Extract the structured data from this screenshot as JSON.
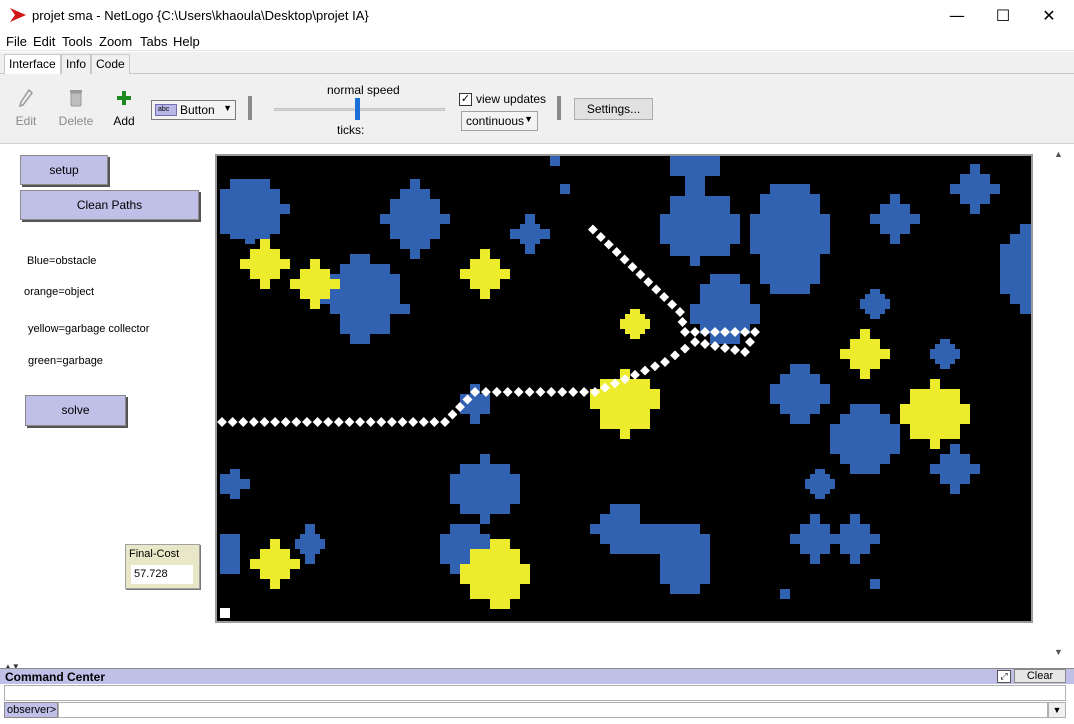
{
  "window": {
    "title": "projet sma - NetLogo {C:\\Users\\khaoula\\Desktop\\projet IA}",
    "controls": {
      "minimize": "—",
      "maximize": "☐",
      "close": "✕"
    }
  },
  "menu": [
    "File",
    "Edit",
    "Tools",
    "Zoom",
    "Tabs",
    "Help"
  ],
  "tabs": [
    "Interface",
    "Info",
    "Code"
  ],
  "toolbar": {
    "edit": "Edit",
    "delete": "Delete",
    "add": "Add",
    "widget_type": "Button",
    "widget_mini": "abc",
    "speed_label": "normal speed",
    "speed_value": 0.5,
    "ticks_label": "ticks:",
    "view_updates_label": "view updates",
    "view_updates_checked": true,
    "update_mode": "continuous",
    "settings": "Settings..."
  },
  "buttons": {
    "setup": "setup",
    "clean_paths": "Clean Paths",
    "solve": "solve"
  },
  "notes": {
    "blue": "Blue=obstacle",
    "orange": "orange=object",
    "yellow": "yellow=garbage collector",
    "green": "green=garbage"
  },
  "monitor": {
    "label": "Final-Cost",
    "value": "57.728"
  },
  "colors": {
    "obstacle": "#3161b1",
    "collector": "#ecec2c",
    "path": "#ffffff",
    "world_bg": "#000000",
    "button_bg": "#bfbfe8"
  },
  "command_center": {
    "title": "Command Center",
    "clear": "Clear",
    "observer": "observer>"
  }
}
